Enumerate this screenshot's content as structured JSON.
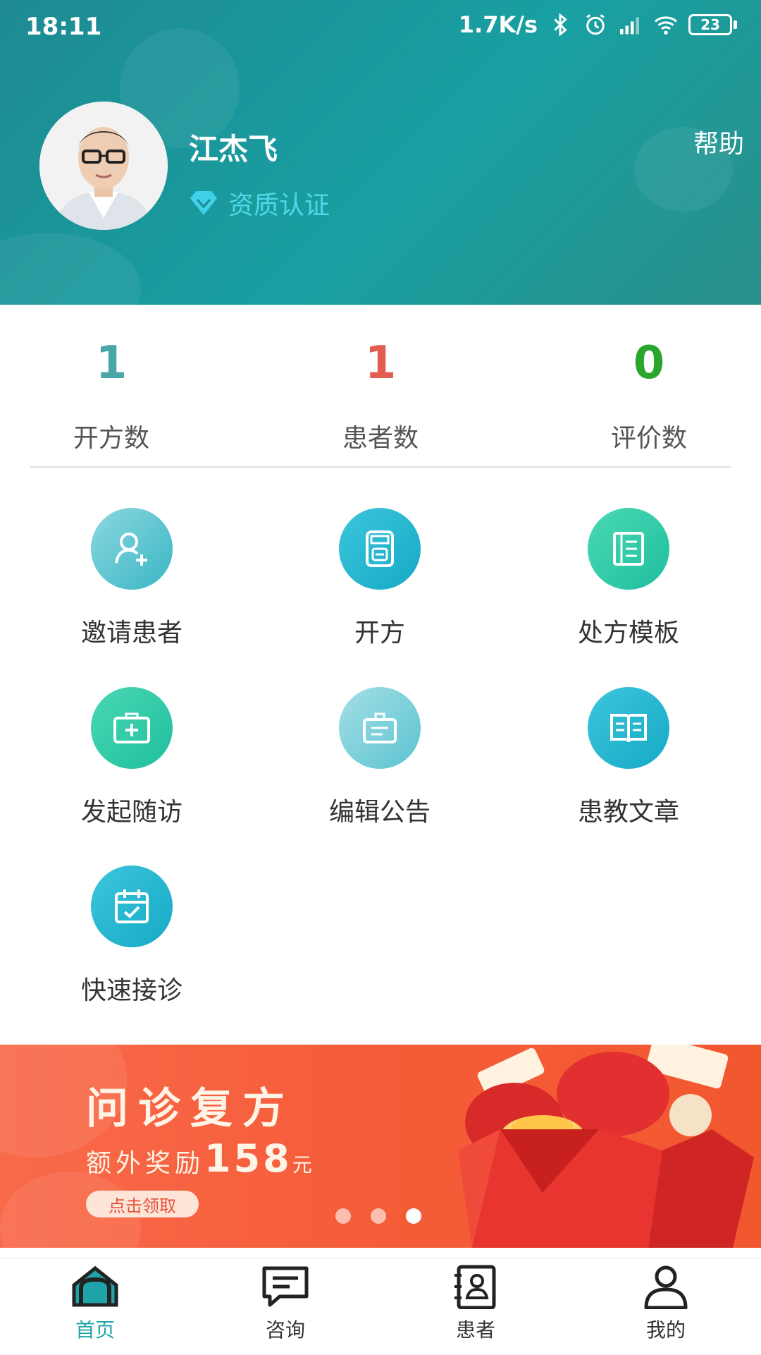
{
  "status_bar": {
    "time": "18:11",
    "net_speed": "1.7K/s",
    "battery": "23"
  },
  "profile": {
    "name": "江杰飞",
    "cert_label": "资质认证",
    "help_label": "帮助"
  },
  "stats": [
    {
      "value": "1",
      "label": "开方数",
      "color": "#4aa6a8"
    },
    {
      "value": "1",
      "label": "患者数",
      "color": "#e25c4f"
    },
    {
      "value": "0",
      "label": "评价数",
      "color": "#2aa52e"
    }
  ],
  "menu": [
    {
      "label": "邀请患者",
      "icon": "add-user-icon"
    },
    {
      "label": "开方",
      "icon": "prescription-icon"
    },
    {
      "label": "处方模板",
      "icon": "document-icon"
    },
    {
      "label": "发起随访",
      "icon": "medical-kit-icon"
    },
    {
      "label": "编辑公告",
      "icon": "notice-board-icon"
    },
    {
      "label": "患教文章",
      "icon": "book-icon"
    },
    {
      "label": "快速接诊",
      "icon": "calendar-check-icon"
    }
  ],
  "banner": {
    "title": "问诊复方",
    "subtitle": "额外奖励",
    "amount": "158",
    "unit": "元",
    "button": "点击领取",
    "page_count": 3,
    "active_page": 3
  },
  "tabs": [
    {
      "label": "首页",
      "icon": "home-icon",
      "active": true
    },
    {
      "label": "咨询",
      "icon": "chat-icon",
      "active": false
    },
    {
      "label": "患者",
      "icon": "contacts-icon",
      "active": false
    },
    {
      "label": "我的",
      "icon": "person-icon",
      "active": false
    }
  ],
  "colors": {
    "accent": "#1fa3a8",
    "header_bg": "#1e8a92",
    "banner_bg": "#f55d3a"
  }
}
